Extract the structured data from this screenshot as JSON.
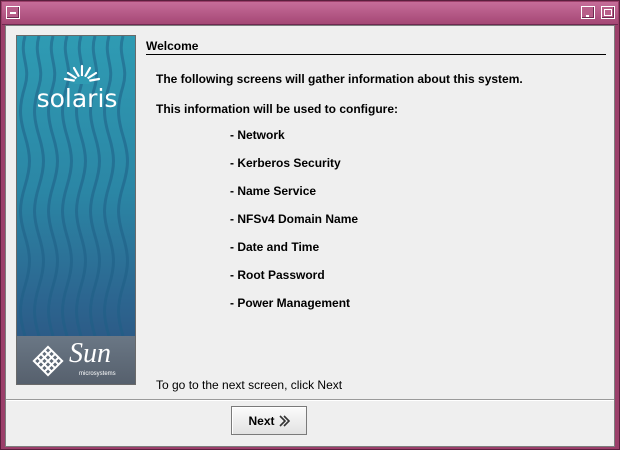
{
  "branding": {
    "product_logo": "solaris",
    "company_logo": "Sun",
    "company_sub": "microsystems"
  },
  "page": {
    "heading": "Welcome",
    "intro": "The following screens will gather information about this system.",
    "config_intro": "This information will be used to configure:",
    "config_items": [
      "- Network",
      "- Kerberos Security",
      "- Name Service",
      "- NFSv4 Domain Name",
      "- Date and Time",
      "- Root Password",
      "- Power Management"
    ],
    "footer_hint": "To go to the next screen, click Next"
  },
  "buttons": {
    "next_label": "Next"
  },
  "colors": {
    "titlebar": "#a54775",
    "window_bg": "#efefef",
    "panel_top": "#2f9bb3",
    "panel_bottom": "#2c4f7d"
  },
  "icons": {
    "window_menu": "window-menu-icon",
    "minimize": "minimize-icon",
    "maximize": "maximize-icon",
    "next_arrow": "chevron-right-icon"
  }
}
